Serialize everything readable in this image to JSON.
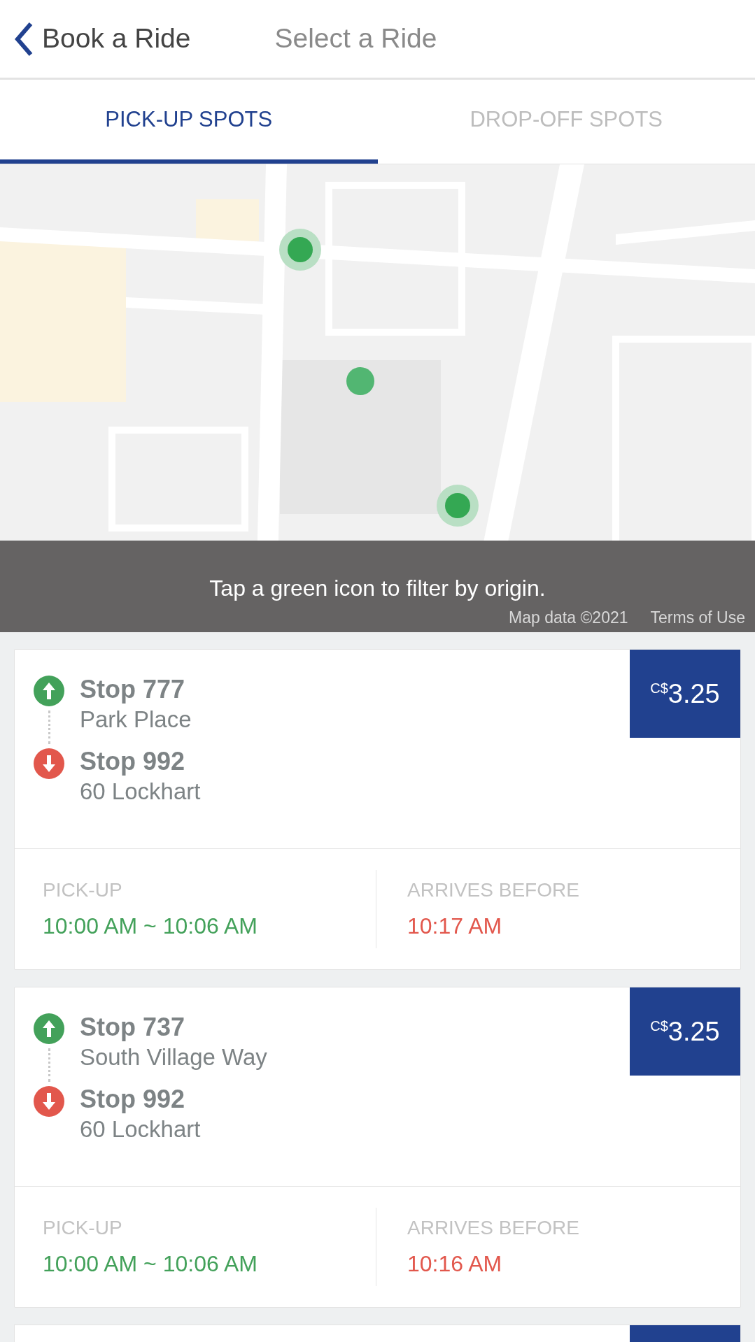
{
  "header": {
    "back_label": "Book a Ride",
    "title": "Select a Ride"
  },
  "tabs": [
    {
      "label": "PICK-UP SPOTS",
      "selected": true
    },
    {
      "label": "DROP-OFF SPOTS",
      "selected": false
    }
  ],
  "map": {
    "hint": "Tap a green icon to filter by origin.",
    "attribution": "Map data ©2021",
    "terms": "Terms of Use"
  },
  "rides": [
    {
      "price_currency": "C$",
      "price": "3.25",
      "origin_stop": "Stop 777",
      "origin_place": "Park Place",
      "dest_stop": "Stop 992",
      "dest_place": "60 Lockhart",
      "pickup_label": "PICK-UP",
      "pickup_time": "10:00 AM ~ 10:06 AM",
      "arrives_label": "ARRIVES BEFORE",
      "arrives_time": "10:17 AM"
    },
    {
      "price_currency": "C$",
      "price": "3.25",
      "origin_stop": "Stop 737",
      "origin_place": "South Village Way",
      "dest_stop": "Stop 992",
      "dest_place": "60 Lockhart",
      "pickup_label": "PICK-UP",
      "pickup_time": "10:00 AM ~ 10:06 AM",
      "arrives_label": "ARRIVES BEFORE",
      "arrives_time": "10:16 AM"
    }
  ]
}
